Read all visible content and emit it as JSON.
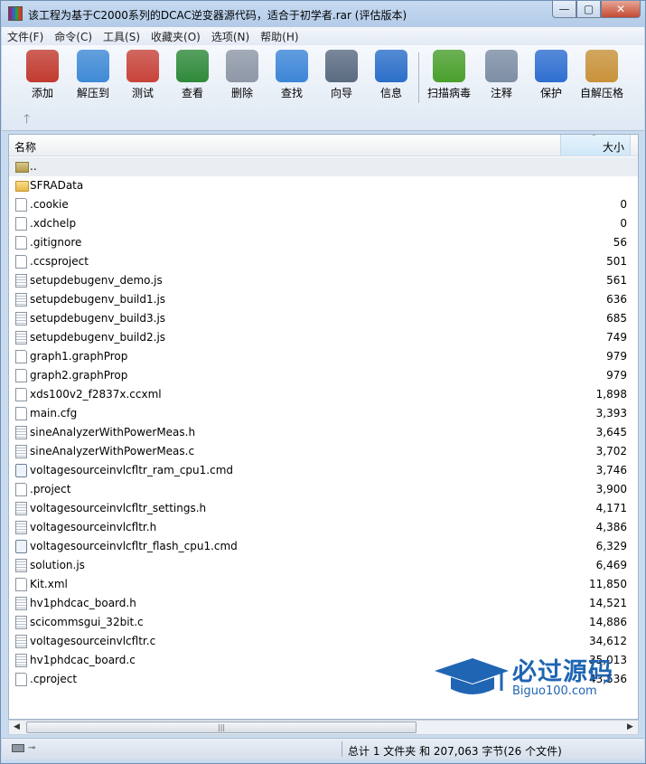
{
  "window": {
    "title": "该工程为基于C2000系列的DCAC逆变器源代码，适合于初学者.rar (评估版本)",
    "controls": {
      "minimize": "—",
      "maximize": "▢",
      "close": "✕"
    }
  },
  "menu": [
    "文件(F)",
    "命令(C)",
    "工具(S)",
    "收藏夹(O)",
    "选项(N)",
    "帮助(H)"
  ],
  "toolbar": [
    {
      "label": "添加",
      "icon": "add-archive-icon",
      "color": "#c23b2f"
    },
    {
      "label": "解压到",
      "icon": "extract-folder-icon",
      "color": "#3f8ad6"
    },
    {
      "label": "测试",
      "icon": "test-clipboard-icon",
      "color": "#c8443a"
    },
    {
      "label": "查看",
      "icon": "view-book-icon",
      "color": "#2f8a3a"
    },
    {
      "label": "删除",
      "icon": "trash-icon",
      "color": "#8e98a6"
    },
    {
      "label": "查找",
      "icon": "search-magnifier-icon",
      "color": "#3d86d8"
    },
    {
      "label": "向导",
      "icon": "wizard-wand-icon",
      "color": "#5b6b80"
    },
    {
      "label": "信息",
      "icon": "info-icon",
      "color": "#2c6fc9"
    },
    {
      "label": "扫描病毒",
      "icon": "virus-scan-icon",
      "color": "#4aa02c"
    },
    {
      "label": "注释",
      "icon": "comment-icon",
      "color": "#7e8ea4"
    },
    {
      "label": "保护",
      "icon": "shield-icon",
      "color": "#2f6fd0"
    },
    {
      "label": "自解压格",
      "icon": "sfx-box-icon",
      "color": "#c9923a"
    }
  ],
  "list": {
    "columns": {
      "name": "名称",
      "size": "大小"
    },
    "rows": [
      {
        "name": "..",
        "size": "",
        "type": "folder-up"
      },
      {
        "name": "SFRAData",
        "size": "",
        "type": "folder"
      },
      {
        "name": ".cookie",
        "size": "0",
        "type": "plain"
      },
      {
        "name": ".xdchelp",
        "size": "0",
        "type": "plain"
      },
      {
        "name": ".gitignore",
        "size": "56",
        "type": "plain"
      },
      {
        "name": ".ccsproject",
        "size": "501",
        "type": "plain"
      },
      {
        "name": "setupdebugenv_demo.js",
        "size": "561",
        "type": "doc"
      },
      {
        "name": "setupdebugenv_build1.js",
        "size": "636",
        "type": "doc"
      },
      {
        "name": "setupdebugenv_build3.js",
        "size": "685",
        "type": "doc"
      },
      {
        "name": "setupdebugenv_build2.js",
        "size": "749",
        "type": "doc"
      },
      {
        "name": "graph1.graphProp",
        "size": "979",
        "type": "plain"
      },
      {
        "name": "graph2.graphProp",
        "size": "979",
        "type": "plain"
      },
      {
        "name": "xds100v2_f2837x.ccxml",
        "size": "1,898",
        "type": "plain"
      },
      {
        "name": "main.cfg",
        "size": "3,393",
        "type": "plain"
      },
      {
        "name": "sineAnalyzerWithPowerMeas.h",
        "size": "3,645",
        "type": "doc"
      },
      {
        "name": "sineAnalyzerWithPowerMeas.c",
        "size": "3,702",
        "type": "doc"
      },
      {
        "name": "voltagesourceinvlcfltr_ram_cpu1.cmd",
        "size": "3,746",
        "type": "cmd"
      },
      {
        "name": ".project",
        "size": "3,900",
        "type": "plain"
      },
      {
        "name": "voltagesourceinvlcfltr_settings.h",
        "size": "4,171",
        "type": "doc"
      },
      {
        "name": "voltagesourceinvlcfltr.h",
        "size": "4,386",
        "type": "doc"
      },
      {
        "name": "voltagesourceinvlcfltr_flash_cpu1.cmd",
        "size": "6,329",
        "type": "cmd"
      },
      {
        "name": "solution.js",
        "size": "6,469",
        "type": "doc"
      },
      {
        "name": "Kit.xml",
        "size": "11,850",
        "type": "plain"
      },
      {
        "name": "hv1phdcac_board.h",
        "size": "14,521",
        "type": "doc"
      },
      {
        "name": "scicommsgui_32bit.c",
        "size": "14,886",
        "type": "doc"
      },
      {
        "name": "voltagesourceinvlcfltr.c",
        "size": "34,612",
        "type": "doc"
      },
      {
        "name": "hv1phdcac_board.c",
        "size": "35,013",
        "type": "doc"
      },
      {
        "name": ".cproject",
        "size": "43,536",
        "type": "plain"
      }
    ]
  },
  "watermark": {
    "text": "必过源码",
    "sub": "Biguo100.com",
    "color": "#1f65b3"
  },
  "statusbar": {
    "summary": "总计 1 文件夹 和 207,063 字节(26 个文件)"
  }
}
